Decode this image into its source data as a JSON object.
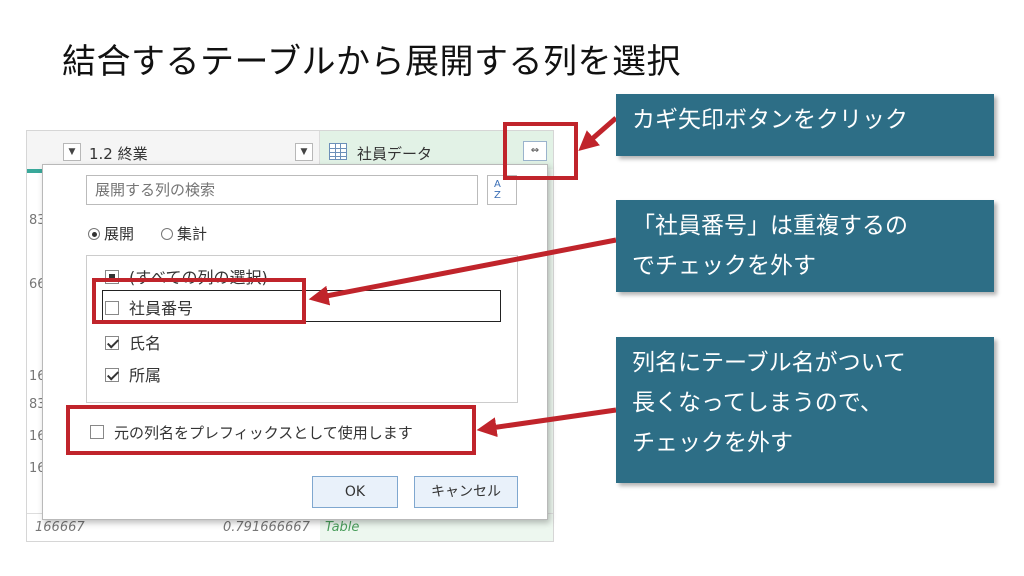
{
  "slide": {
    "title": "結合するテーブルから展開する列を選択"
  },
  "grid": {
    "col_end_type": "1.2",
    "col_end_label": "1.2  終業",
    "col_shain_label": "社員データ",
    "bg_nums": [
      "83",
      "66",
      "16",
      "83",
      "16",
      "16"
    ],
    "bottom_left": "166667",
    "bottom_value": "0.791666667",
    "bottom_table": "Table"
  },
  "panel": {
    "search_placeholder": "展開する列の検索",
    "sort_icon_top": "A",
    "sort_icon_bottom": "Z",
    "radio_expand": "展開",
    "radio_aggregate": "集計",
    "items": [
      {
        "label": "(すべての列の選択)",
        "state": "partial"
      },
      {
        "label": "社員番号",
        "state": "unchecked"
      },
      {
        "label": "氏名",
        "state": "checked"
      },
      {
        "label": "所属",
        "state": "checked"
      }
    ],
    "prefix_label": "元の列名をプレフィックスとして使用します",
    "ok_label": "OK",
    "cancel_label": "キャンセル"
  },
  "callouts": {
    "c1": [
      "カギ矢印ボタンをクリック"
    ],
    "c2": [
      "「社員番号」は重複するの",
      "でチェックを外す"
    ],
    "c3": [
      "列名にテーブル名がついて",
      "長くなってしまうので、",
      "チェックを外す"
    ]
  },
  "colors": {
    "callout_bg": "#2d6e86",
    "highlight": "#c0242b",
    "table_green": "#edf7ef"
  }
}
